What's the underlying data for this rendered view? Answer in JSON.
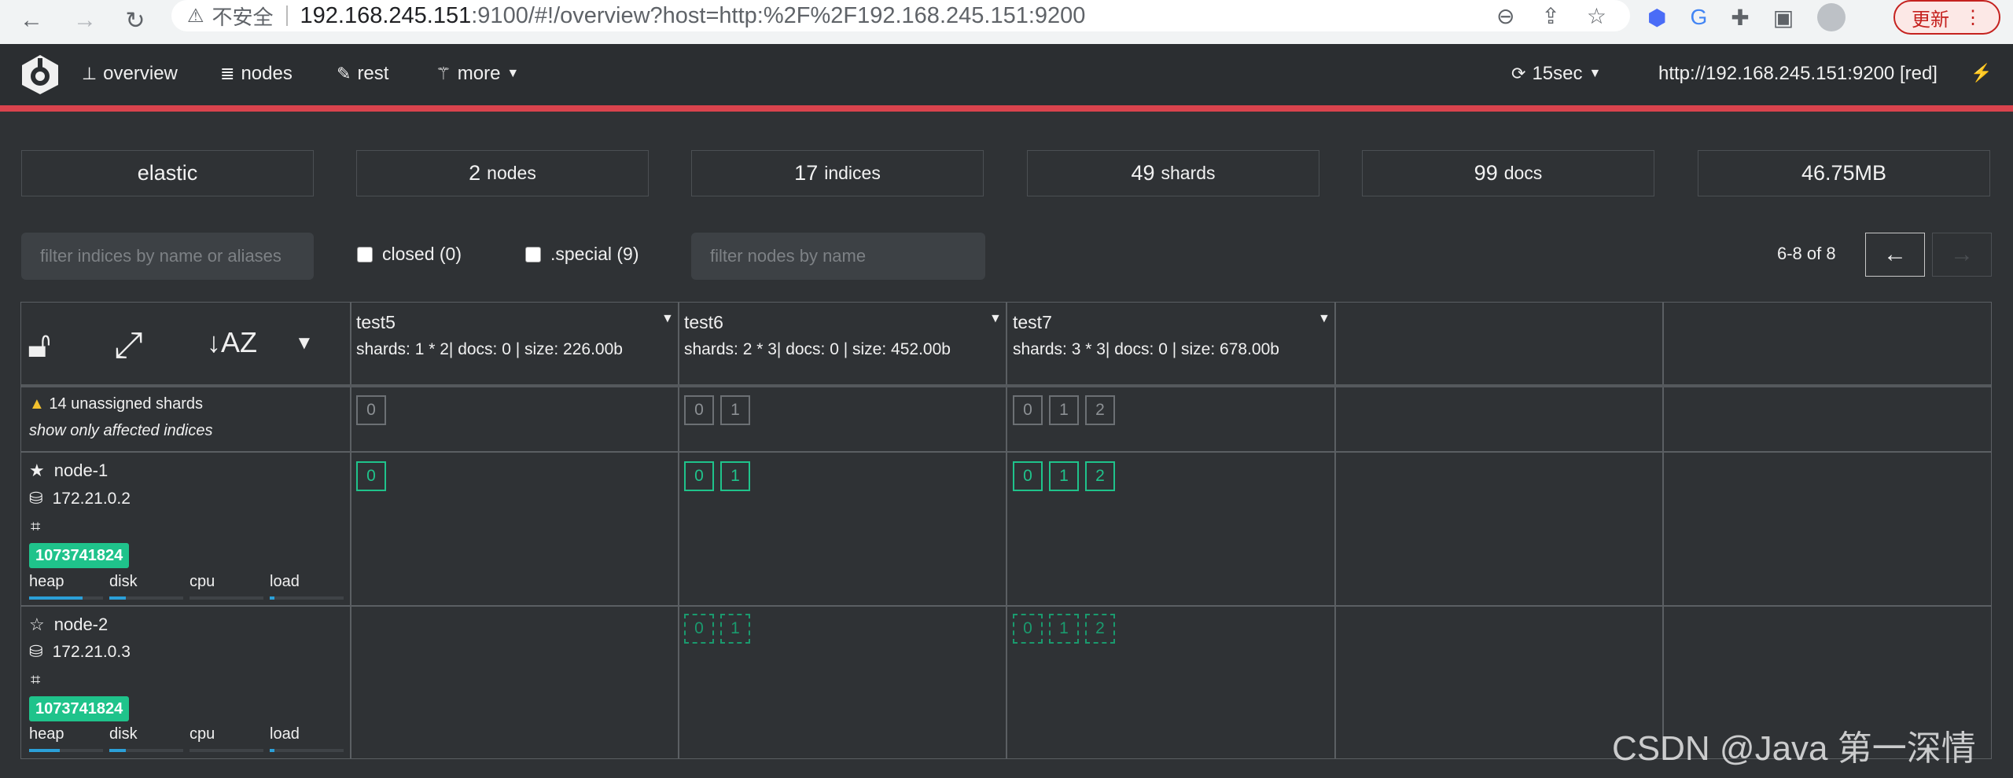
{
  "browser": {
    "insecure_label": "不安全",
    "url_host": "192.168.245.151",
    "url_rest": ":9100/#!/overview?host=http:%2F%2F192.168.245.151:9200",
    "update_label": "更新"
  },
  "header": {
    "nav": {
      "overview": "overview",
      "nodes": "nodes",
      "rest": "rest",
      "more": "more"
    },
    "refresh": "15sec",
    "cluster_url": "http://192.168.245.151:9200 [red]"
  },
  "stats": {
    "cluster_name": "elastic",
    "nodes_count": "2",
    "nodes_label": "nodes",
    "indices_count": "17",
    "indices_label": "indices",
    "shards_count": "49",
    "shards_label": "shards",
    "docs_count": "99",
    "docs_label": "docs",
    "size": "46.75MB"
  },
  "filters": {
    "indices_placeholder": "filter indices by name or aliases",
    "closed_label": "closed (0)",
    "special_label": ".special (9)",
    "nodes_placeholder": "filter nodes by name",
    "pager": "6-8 of 8",
    "prev": "←",
    "next": "→"
  },
  "indices": [
    {
      "name": "test5",
      "info": "shards: 1 * 2| docs: 0 | size: 226.00b",
      "shards": [
        "0"
      ]
    },
    {
      "name": "test6",
      "info": "shards: 2 * 3| docs: 0 | size: 452.00b",
      "shards": [
        "0",
        "1"
      ]
    },
    {
      "name": "test7",
      "info": "shards: 3 * 3| docs: 0 | size: 678.00b",
      "shards": [
        "0",
        "1",
        "2"
      ]
    }
  ],
  "unassigned": {
    "text": "14 unassigned shards",
    "link": "show only affected indices"
  },
  "nodes": [
    {
      "name": "node-1",
      "ip": "172.21.0.2",
      "badge": "1073741824",
      "master": true,
      "metrics": {
        "heap": 0.72,
        "disk": 0.22,
        "cpu": 0.0,
        "load": 0.06
      }
    },
    {
      "name": "node-2",
      "ip": "172.21.0.3",
      "badge": "1073741824",
      "master": false,
      "metrics": {
        "heap": 0.42,
        "disk": 0.22,
        "cpu": 0.0,
        "load": 0.06
      }
    }
  ],
  "metric_labels": {
    "heap": "heap",
    "disk": "disk",
    "cpu": "cpu",
    "load": "load"
  },
  "watermark": "CSDN @Java 第一深情",
  "colors": {
    "primary_shard": "#1fc38b",
    "status_bar": "#d9434d",
    "metric_bar": "#2ba0d8"
  }
}
